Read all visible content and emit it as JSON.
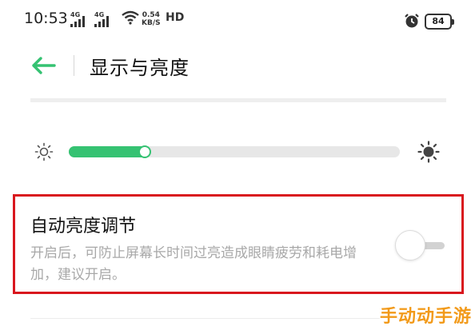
{
  "status_bar": {
    "time": "10:53",
    "signal1_label": "4G",
    "signal2_label": "4G",
    "speed_value": "0.54",
    "speed_unit": "KB/S",
    "hd_label": "HD",
    "battery": "84"
  },
  "header": {
    "title": "显示与亮度",
    "back_icon": "back-arrow-icon"
  },
  "brightness": {
    "level": 0.22,
    "accent": "#35c272",
    "low_icon": "sun-low-icon",
    "high_icon": "sun-high-icon"
  },
  "auto_brightness": {
    "title": "自动亮度调节",
    "description": "开启后，可防止屏幕长时间过亮造成眼睛疲劳和耗电增加，建议开启。",
    "enabled": false
  },
  "watermark": "手动动手游"
}
